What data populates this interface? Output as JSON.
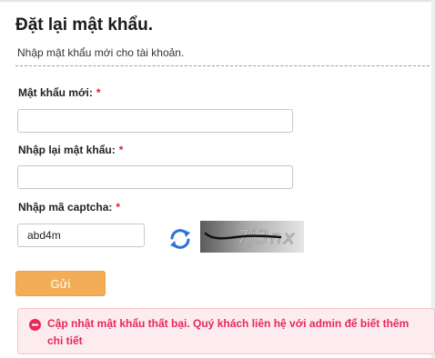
{
  "page": {
    "title": "Đặt lại mật khẩu.",
    "subtitle": "Nhập mật khẩu mới cho tài khoản."
  },
  "form": {
    "new_password_label": "Mật khẩu mới:",
    "new_password_value": "",
    "confirm_password_label": "Nhập lại mật khẩu:",
    "confirm_password_value": "",
    "captcha_label": "Nhập mã captcha:",
    "captcha_value": "abd4m",
    "captcha_image_text": "7j3nx",
    "required_mark": "*",
    "submit_label": "Gửi"
  },
  "alert": {
    "message": "Cập nhật mật khẩu thất bại. Quý khách liên hệ với admin để biết thêm chi tiết",
    "icon": "minus-circle-icon"
  },
  "colors": {
    "required": "#d9232e",
    "submit_button": "#f3ad57",
    "alert_text": "#e6285a",
    "alert_background": "#fdecef",
    "refresh_icon": "#2b73d9"
  }
}
